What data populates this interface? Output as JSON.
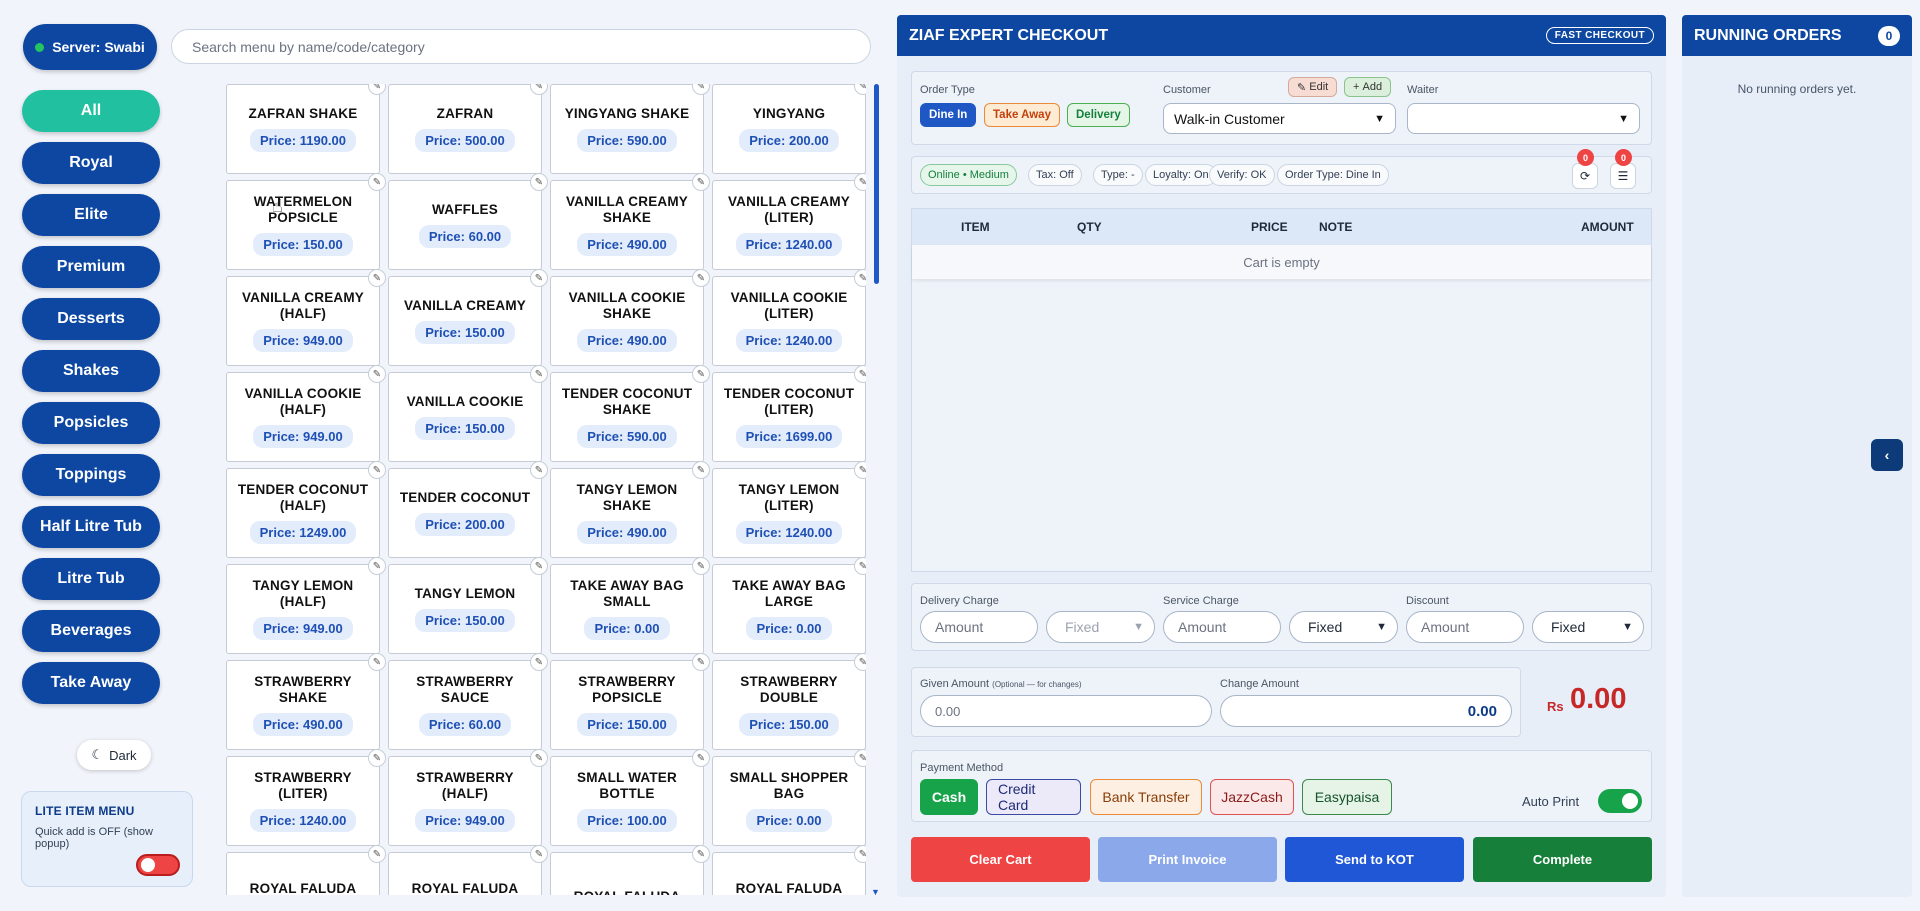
{
  "server": {
    "label": "Server: Swabi"
  },
  "search": {
    "placeholder": "Search menu by name/code/category"
  },
  "categories": [
    "All",
    "Royal",
    "Elite",
    "Premium",
    "Desserts",
    "Shakes",
    "Popsicles",
    "Toppings",
    "Half Litre Tub",
    "Litre Tub",
    "Beverages",
    "Take Away"
  ],
  "theme_toggle": {
    "label": "Dark"
  },
  "lite_menu": {
    "title": "LITE ITEM MENU",
    "subtitle": "Quick add is OFF (show popup)",
    "enabled": false
  },
  "menu_items": [
    {
      "name": "ZAFRAN SHAKE",
      "price": "Price: 1190.00"
    },
    {
      "name": "ZAFRAN",
      "price": "Price: 500.00"
    },
    {
      "name": "YINGYANG SHAKE",
      "price": "Price: 590.00"
    },
    {
      "name": "YINGYANG",
      "price": "Price: 200.00"
    },
    {
      "name": "WATERMELON POPSICLE",
      "price": "Price: 150.00"
    },
    {
      "name": "WAFFLES",
      "price": "Price: 60.00"
    },
    {
      "name": "VANILLA CREAMY SHAKE",
      "price": "Price: 490.00"
    },
    {
      "name": "VANILLA CREAMY (LITER)",
      "price": "Price: 1240.00"
    },
    {
      "name": "VANILLA CREAMY (HALF)",
      "price": "Price: 949.00"
    },
    {
      "name": "VANILLA CREAMY",
      "price": "Price: 150.00"
    },
    {
      "name": "VANILLA COOKIE SHAKE",
      "price": "Price: 490.00"
    },
    {
      "name": "VANILLA COOKIE (LITER)",
      "price": "Price: 1240.00"
    },
    {
      "name": "VANILLA COOKIE (HALF)",
      "price": "Price: 949.00"
    },
    {
      "name": "VANILLA COOKIE",
      "price": "Price: 150.00"
    },
    {
      "name": "TENDER COCONUT SHAKE",
      "price": "Price: 590.00"
    },
    {
      "name": "TENDER COCONUT (LITER)",
      "price": "Price: 1699.00"
    },
    {
      "name": "TENDER COCONUT (HALF)",
      "price": "Price: 1249.00"
    },
    {
      "name": "TENDER COCONUT",
      "price": "Price: 200.00"
    },
    {
      "name": "TANGY LEMON SHAKE",
      "price": "Price: 490.00"
    },
    {
      "name": "TANGY LEMON (LITER)",
      "price": "Price: 1240.00"
    },
    {
      "name": "TANGY LEMON (HALF)",
      "price": "Price: 949.00"
    },
    {
      "name": "TANGY LEMON",
      "price": "Price: 150.00"
    },
    {
      "name": "TAKE AWAY BAG SMALL",
      "price": "Price: 0.00"
    },
    {
      "name": "TAKE AWAY BAG LARGE",
      "price": "Price: 0.00"
    },
    {
      "name": "STRAWBERRY SHAKE",
      "price": "Price: 490.00"
    },
    {
      "name": "STRAWBERRY SAUCE",
      "price": "Price: 60.00"
    },
    {
      "name": "STRAWBERRY POPSICLE",
      "price": "Price: 150.00"
    },
    {
      "name": "STRAWBERRY DOUBLE",
      "price": "Price: 150.00"
    },
    {
      "name": "STRAWBERRY (LITER)",
      "price": "Price: 1240.00"
    },
    {
      "name": "STRAWBERRY (HALF)",
      "price": "Price: 949.00"
    },
    {
      "name": "SMALL WATER BOTTLE",
      "price": "Price: 100.00"
    },
    {
      "name": "SMALL SHOPPER BAG",
      "price": "Price: 0.00"
    },
    {
      "name": "ROYAL FALUDA (LITER)",
      "price": ""
    },
    {
      "name": "ROYAL FALUDA (HALF)",
      "price": ""
    },
    {
      "name": "ROYAL FALUDA",
      "price": ""
    },
    {
      "name": "ROYAL FALUDA SHAKE",
      "price": ""
    }
  ],
  "checkout": {
    "title": "ZIAF EXPERT CHECKOUT",
    "fast_badge": "FAST CHECKOUT",
    "order_type_label": "Order Type",
    "order_types": [
      "Dine In",
      "Take Away",
      "Delivery"
    ],
    "customer_label": "Customer",
    "edit_label": "Edit",
    "add_label": "Add",
    "customer_value": "Walk-in Customer",
    "waiter_label": "Waiter",
    "waiter_value": "",
    "chips": [
      "Online • Medium",
      "Tax: Off",
      "Type: -",
      "Loyalty: On",
      "Verify: OK",
      "Order Type: Dine In"
    ],
    "sync_count": "0",
    "queue_count": "0",
    "columns": [
      "ITEM",
      "QTY",
      "PRICE",
      "NOTE",
      "AMOUNT"
    ],
    "cart_empty": "Cart is empty",
    "delivery_label": "Delivery Charge",
    "service_label": "Service Charge",
    "discount_label": "Discount",
    "amount_placeholder": "Amount",
    "delivery_type": "Fixed",
    "service_type": "Fixed",
    "discount_type": "Fixed",
    "given_label": "Given Amount",
    "given_hint": "(Optional — for changes)",
    "given_placeholder": "0.00",
    "change_label": "Change Amount",
    "change_value": "0.00",
    "currency": "Rs",
    "total": "0.00",
    "payment_label": "Payment Method",
    "payments": [
      "Cash",
      "Credit Card",
      "Bank Transfer",
      "JazzCash",
      "Easypaisa"
    ],
    "auto_print_label": "Auto Print",
    "auto_print": true,
    "actions": [
      "Clear Cart",
      "Print Invoice",
      "Send to KOT",
      "Complete"
    ]
  },
  "running_orders": {
    "title": "RUNNING ORDERS",
    "count": "0",
    "empty": "No running orders yet."
  },
  "colors": {
    "brand": "#0d47a1",
    "accent": "#20c0a0",
    "danger": "#ef4444",
    "success": "#16a34a"
  },
  "icons": {
    "pin": "pin-icon",
    "moon": "moon-icon",
    "sync": "sync-icon",
    "queue": "queue-icon",
    "collapse": "chevron-left-icon"
  }
}
